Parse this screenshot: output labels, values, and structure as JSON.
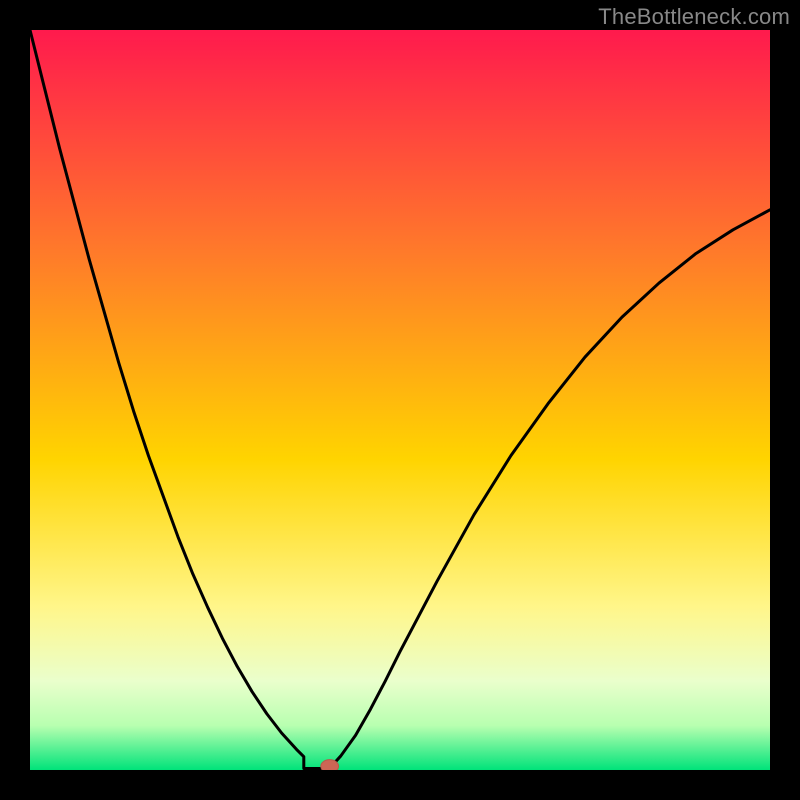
{
  "watermark": "TheBottleneck.com",
  "colors": {
    "frame": "#000000",
    "curve": "#000000",
    "marker_fill": "#cc6655",
    "marker_stroke": "#b85a4a",
    "grad_top": "#ff1a4d",
    "grad_upper_mid": "#ff7a2a",
    "grad_mid": "#ffd400",
    "grad_low1": "#fff68a",
    "grad_low2": "#eaffcc",
    "grad_low3": "#b8ffb0",
    "grad_bottom": "#00e37a"
  },
  "chart_data": {
    "type": "line",
    "title": "",
    "xlabel": "",
    "ylabel": "",
    "xlim": [
      0,
      100
    ],
    "ylim": [
      0,
      100
    ],
    "x": [
      0,
      2,
      4,
      6,
      8,
      10,
      12,
      14,
      16,
      18,
      20,
      22,
      24,
      26,
      28,
      30,
      32,
      34,
      36,
      37,
      38,
      39,
      39.5,
      40,
      40.5,
      41,
      42,
      44,
      46,
      48,
      50,
      55,
      60,
      65,
      70,
      75,
      80,
      85,
      90,
      95,
      100
    ],
    "values": [
      100,
      92,
      84,
      76.5,
      69,
      62,
      55,
      48.5,
      42.5,
      37,
      31.5,
      26.5,
      22,
      17.8,
      14,
      10.6,
      7.6,
      5,
      2.8,
      1.8,
      1.1,
      0.6,
      0.35,
      0.2,
      0.35,
      0.8,
      1.9,
      4.7,
      8.2,
      12,
      16,
      25.5,
      34.5,
      42.5,
      49.5,
      55.8,
      61.2,
      65.8,
      69.8,
      73,
      75.7
    ],
    "minimum_x": 40,
    "flat_start_x": 37,
    "flat_end_x": 40,
    "flat_y": 0.2,
    "marker": {
      "x": 40.5,
      "y": 0.5,
      "rx": 1.2,
      "ry": 0.9
    },
    "annotations": []
  }
}
